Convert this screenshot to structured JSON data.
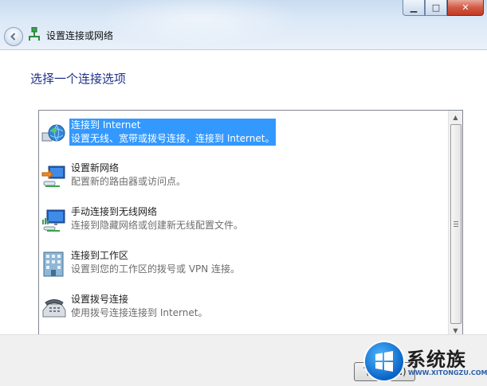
{
  "window": {
    "title": "设置连接或网络",
    "controls": {
      "minimize": "▁",
      "maximize": "□",
      "close": "✕"
    }
  },
  "heading": "选择一个连接选项",
  "options": [
    {
      "title": "连接到 Internet",
      "desc": "设置无线、宽带或拨号连接，连接到 Internet。",
      "selected": true,
      "icon": "globe-network-icon"
    },
    {
      "title": "设置新网络",
      "desc": "配置新的路由器或访问点。",
      "selected": false,
      "icon": "new-network-icon"
    },
    {
      "title": "手动连接到无线网络",
      "desc": "连接到隐藏网络或创建新无线配置文件。",
      "selected": false,
      "icon": "wireless-network-icon"
    },
    {
      "title": "连接到工作区",
      "desc": "设置到您的工作区的拨号或 VPN 连接。",
      "selected": false,
      "icon": "workplace-icon"
    },
    {
      "title": "设置拨号连接",
      "desc": "使用拨号连接连接到 Internet。",
      "selected": false,
      "icon": "dialup-phone-icon"
    }
  ],
  "buttons": {
    "next": "下一步(N)"
  },
  "watermark": {
    "brand": "系统族",
    "url": "WWW.XITONGZU.COM"
  },
  "colors": {
    "selection": "#3399ff",
    "heading": "#1e3287"
  }
}
